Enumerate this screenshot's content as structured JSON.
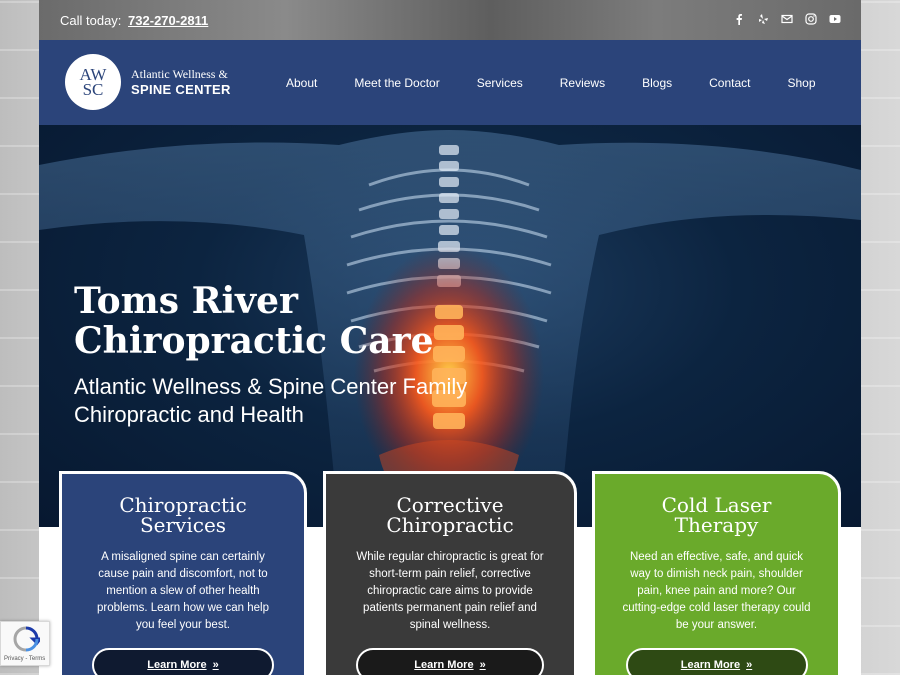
{
  "topbar": {
    "call_label": "Call today:",
    "phone": "732-270-2811",
    "social": [
      "facebook-icon",
      "yelp-icon",
      "email-icon",
      "instagram-icon",
      "youtube-icon"
    ]
  },
  "logo": {
    "monogram_top": "AW",
    "monogram_bottom": "SC",
    "line1": "Atlantic Wellness &",
    "line2": "SPINE CENTER"
  },
  "nav": {
    "items": [
      "About",
      "Meet the Doctor",
      "Services",
      "Reviews",
      "Blogs",
      "Contact",
      "Shop"
    ]
  },
  "hero": {
    "title_line1": "Toms River",
    "title_line2": "Chiropractic Care",
    "subtitle_line1": "Atlantic Wellness & Spine Center Family",
    "subtitle_line2": "Chiropractic and Health"
  },
  "cards": [
    {
      "title_line1": "Chiropractic",
      "title_line2": "Services",
      "text": "A misaligned spine can certainly cause pain and discomfort, not to mention a slew of other health problems. Learn how we can help you feel your best.",
      "button": "Learn More"
    },
    {
      "title_line1": "Corrective",
      "title_line2": "Chiropractic",
      "text": "While regular chiropractic is great for short-term pain relief, corrective chiropractic care aims to provide patients permanent pain relief and spinal wellness.",
      "button": "Learn More"
    },
    {
      "title_line1": "Cold Laser",
      "title_line2": "Therapy",
      "text": "Need an effective, safe, and quick way to dimish neck pain, shoulder pain, knee pain and more? Our cutting-edge cold laser therapy could be your answer.",
      "button": "Learn More"
    }
  ],
  "recaptcha": {
    "text": "Privacy - Terms"
  },
  "colors": {
    "navy": "#2b447a",
    "dark_gray": "#3a3a3a",
    "green": "#6aaa2b",
    "hero_glow": "#ff5a1a"
  }
}
